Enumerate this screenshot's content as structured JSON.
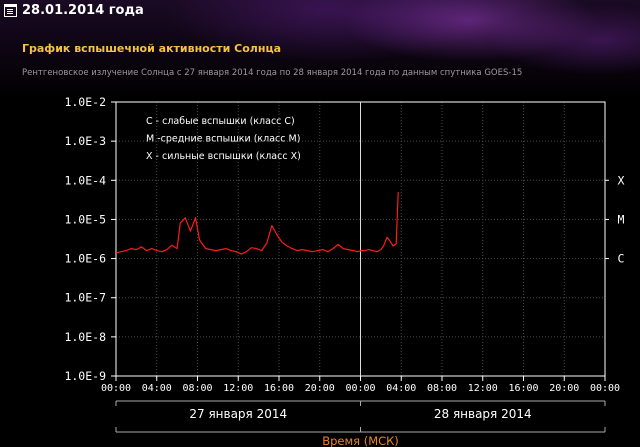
{
  "page": {
    "date": "28.01.2014 года",
    "title": "График вспышечной активности Солнца",
    "subtitle": "Рентгеновское излучение Солнца с 27 января 2014 года по 28 января 2014 года по данным спутника GOES-15"
  },
  "chart_data": {
    "type": "line",
    "y_scale": "log",
    "ylim": [
      "1.0E-9",
      "1.0E-2"
    ],
    "y_ticks": [
      "1.0E-2",
      "1.0E-3",
      "1.0E-4",
      "1.0E-5",
      "1.0E-6",
      "1.0E-7",
      "1.0E-8",
      "1.0E-9"
    ],
    "x_ticks": [
      "00:00",
      "04:00",
      "08:00",
      "12:00",
      "16:00",
      "20:00",
      "00:00",
      "04:00",
      "08:00",
      "12:00",
      "16:00",
      "20:00",
      "00:00"
    ],
    "xlim_hours": [
      0,
      48
    ],
    "grid": true,
    "day_labels": [
      "27 января 2014",
      "28 января 2014"
    ],
    "xlabel": "Время (МСК)",
    "legend": [
      "C - слабые вспышки (класс C)",
      "M -средние вспышки (класс M)",
      "X - сильные вспышки (класс X)"
    ],
    "legend_position": "top-left",
    "flare_classes": [
      {
        "label": "X",
        "value": 0.0001
      },
      {
        "label": "M",
        "value": 1e-05
      },
      {
        "label": "C",
        "value": 1e-06
      }
    ],
    "series_color": "#ff1a1a",
    "current_time_hour": 24,
    "series": [
      {
        "x_hours": [
          0,
          0.5,
          1,
          1.5,
          2,
          2.5,
          3,
          3.5,
          4,
          4.5,
          5,
          5.5,
          6,
          6.3,
          6.8,
          7.3,
          7.8,
          8.2,
          8.8,
          9.3,
          9.8,
          10.3,
          10.8,
          11.3,
          11.8,
          12.3,
          12.8,
          13.3,
          13.8,
          14.3,
          14.8,
          15.3,
          15.8,
          16.3,
          16.8,
          17.3,
          17.8,
          18.3,
          18.8,
          19.3,
          19.8,
          20.3,
          20.8,
          21.3,
          21.8,
          22.3,
          22.8,
          23.3,
          23.7,
          24.1,
          24.4,
          24.8,
          25.2,
          25.6,
          26,
          26.3,
          26.6,
          26.9,
          27.2,
          27.5,
          27.7
        ],
        "values": [
          1.4e-06,
          1.5e-06,
          1.6e-06,
          1.8e-06,
          1.7e-06,
          2e-06,
          1.6e-06,
          1.8e-06,
          1.6e-06,
          1.5e-06,
          1.7e-06,
          2.2e-06,
          1.8e-06,
          8e-06,
          1.1e-05,
          5e-06,
          1.1e-05,
          3e-06,
          1.8e-06,
          1.7e-06,
          1.6e-06,
          1.7e-06,
          1.8e-06,
          1.6e-06,
          1.5e-06,
          1.3e-06,
          1.5e-06,
          1.9e-06,
          1.8e-06,
          1.6e-06,
          2.5e-06,
          7e-06,
          4e-06,
          2.6e-06,
          2.1e-06,
          1.8e-06,
          1.6e-06,
          1.7e-06,
          1.6e-06,
          1.5e-06,
          1.6e-06,
          1.7e-06,
          1.5e-06,
          1.8e-06,
          2.3e-06,
          1.8e-06,
          1.7e-06,
          1.6e-06,
          1.5e-06,
          1.6e-06,
          1.6e-06,
          1.7e-06,
          1.6e-06,
          1.5e-06,
          1.7e-06,
          2.2e-06,
          3.5e-06,
          2.8e-06,
          2.1e-06,
          2.4e-06,
          5e-05
        ]
      }
    ]
  }
}
